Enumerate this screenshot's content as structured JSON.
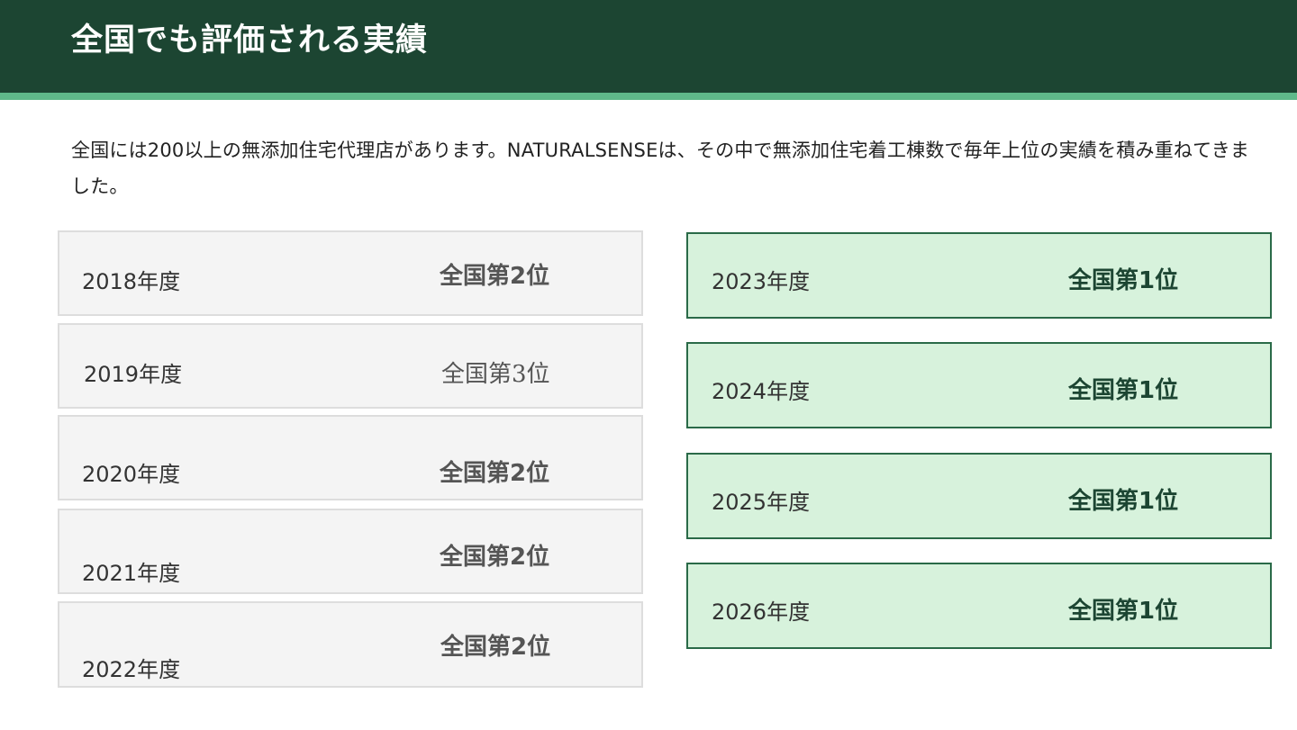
{
  "header": {
    "title": "全国でも評価される実績"
  },
  "intro": {
    "text": "全国には200以上の無添加住宅代理店があります。NATURALSENSEは、その中で無添加住宅着工棟数で毎年上位の実績を積み重ねてきました。"
  },
  "records_left": [
    {
      "year": "2018年度",
      "rank": "全国第2位"
    },
    {
      "year": "2019年度",
      "rank": "全国第3位"
    },
    {
      "year": "2020年度",
      "rank": "全国第2位"
    },
    {
      "year": "2021年度",
      "rank": "全国第2位"
    },
    {
      "year": "2022年度",
      "rank": "全国第2位"
    }
  ],
  "records_right": [
    {
      "year": "2023年度",
      "rank": "全国第1位"
    },
    {
      "year": "2024年度",
      "rank": "全国第1位"
    },
    {
      "year": "2025年度",
      "rank": "全国第1位"
    },
    {
      "year": "2026年度",
      "rank": "全国第1位"
    }
  ],
  "colors": {
    "header_bg": "#1c4532",
    "header_accent": "#5fb98a",
    "card_gray_bg": "#f4f4f4",
    "card_green_bg": "#d7f2dc",
    "card_green_border": "#2a6a48"
  }
}
